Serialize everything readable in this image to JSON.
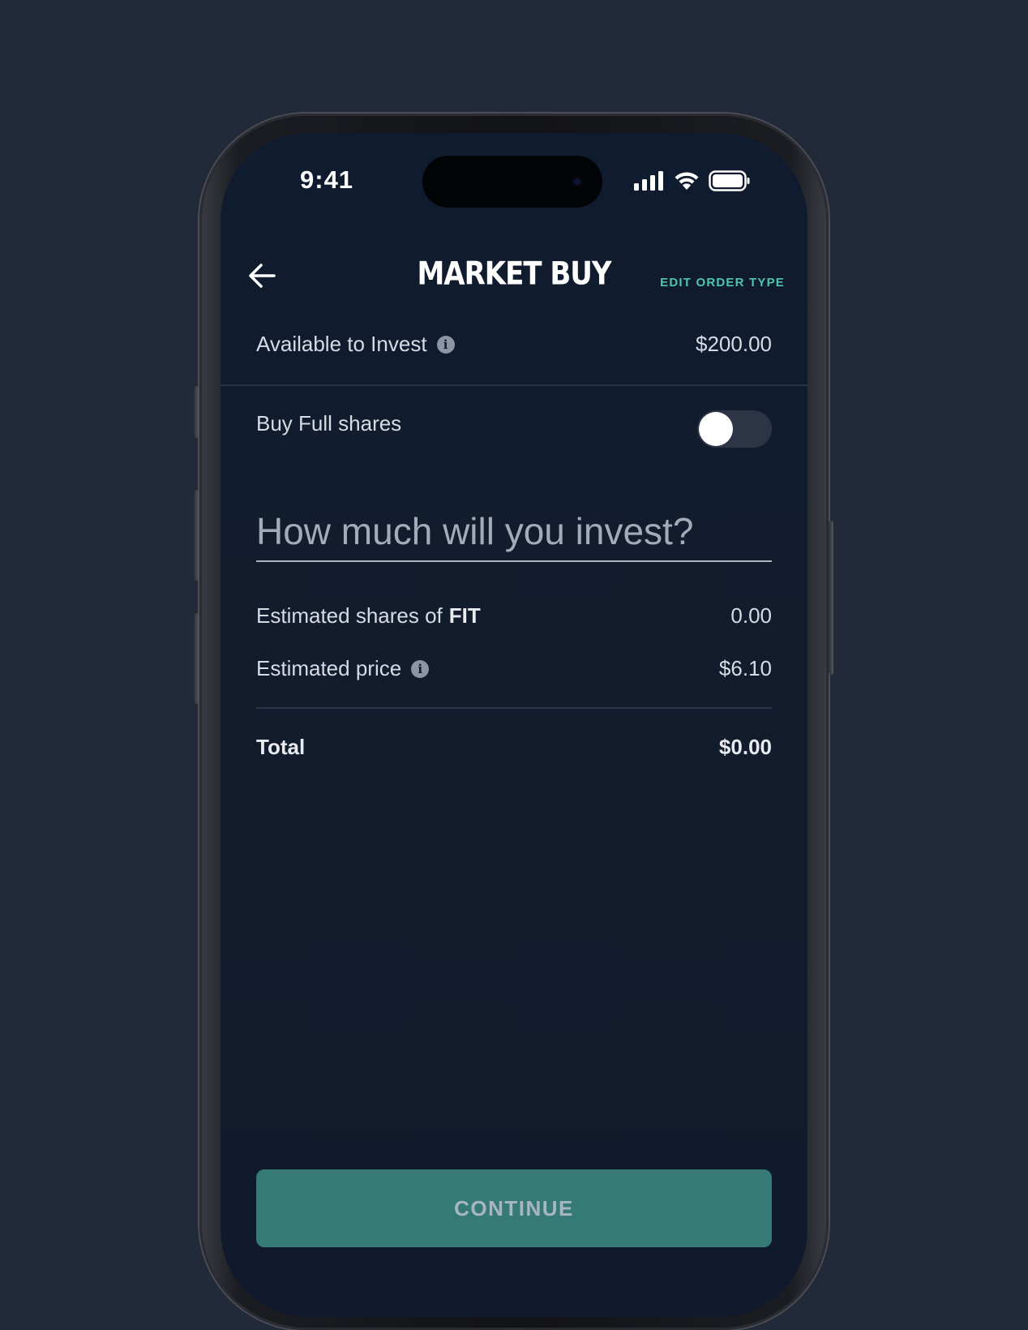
{
  "status_bar": {
    "time": "9:41"
  },
  "header": {
    "back_icon": "arrow-left-icon",
    "title": "MARKET BUY",
    "edit_link": "EDIT ORDER TYPE"
  },
  "available": {
    "label": "Available to Invest",
    "value": "$200.00"
  },
  "full_shares": {
    "label": "Buy Full shares",
    "enabled": false
  },
  "amount": {
    "placeholder": "How much will you invest?"
  },
  "estimates": {
    "shares_label": "Estimated shares of",
    "ticker": "FIT",
    "shares_value": "0.00",
    "price_label": "Estimated price",
    "price_value": "$6.10"
  },
  "total": {
    "label": "Total",
    "value": "$0.00"
  },
  "continue_button": "CONTINUE",
  "colors": {
    "accent": "#4fc5b0",
    "button": "#357a76",
    "background": "#222a3a",
    "screen": "#131c2d"
  }
}
